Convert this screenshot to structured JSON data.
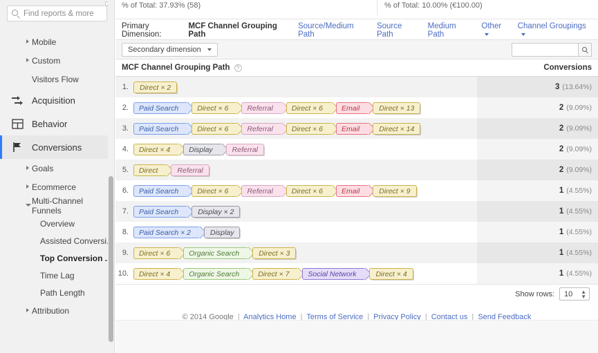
{
  "sidebar": {
    "search_placeholder": "Find reports & more",
    "items": [
      {
        "label": "Mobile",
        "type": "sub",
        "icon": "triangle-right-icon"
      },
      {
        "label": "Custom",
        "type": "sub",
        "icon": "triangle-right-icon"
      },
      {
        "label": "Visitors Flow",
        "type": "sub-noarrow",
        "icon": ""
      },
      {
        "label": "Acquisition",
        "type": "section",
        "icon": "acquisition-arrows-icon"
      },
      {
        "label": "Behavior",
        "type": "section",
        "icon": "behavior-grid-icon"
      },
      {
        "label": "Conversions",
        "type": "section-active",
        "icon": "conversions-flag-icon"
      },
      {
        "label": "Goals",
        "type": "sub",
        "icon": "triangle-right-icon"
      },
      {
        "label": "Ecommerce",
        "type": "sub",
        "icon": "triangle-right-icon"
      },
      {
        "label": "Multi-Channel Funnels",
        "type": "sub-open",
        "icon": "triangle-down-icon"
      },
      {
        "label": "Overview",
        "type": "leaf"
      },
      {
        "label": "Assisted Conversi...",
        "type": "leaf"
      },
      {
        "label": "Top Conversion ...",
        "type": "leaf-selected"
      },
      {
        "label": "Time Lag",
        "type": "leaf"
      },
      {
        "label": "Path Length",
        "type": "leaf"
      },
      {
        "label": "Attribution",
        "type": "sub",
        "icon": "triangle-right-icon"
      }
    ]
  },
  "metrics": {
    "left": "% of Total: 37.93% (58)",
    "right": "% of Total: 10.00% (€100.00)"
  },
  "primary_dimension": {
    "label": "Primary Dimension:",
    "current": "MCF Channel Grouping Path",
    "links": [
      "Source/Medium Path",
      "Source Path",
      "Medium Path"
    ],
    "other": "Other",
    "channel_groupings": "Channel Groupings"
  },
  "toolbar": {
    "secondary_dimension": "Secondary dimension",
    "search_value": "",
    "search_icon": "search-icon"
  },
  "table": {
    "col_path": "MCF Channel Grouping Path",
    "col_conversions": "Conversions",
    "sort_arrow": "↓",
    "help_icon": "?",
    "rows": [
      {
        "num": "1.",
        "conv": "3",
        "pct": "(13.64%)",
        "path": [
          {
            "label": "Direct × 2",
            "cls": "c-direct",
            "term": true
          }
        ]
      },
      {
        "num": "2.",
        "conv": "2",
        "pct": "(9.09%)",
        "path": [
          {
            "label": "Paid Search",
            "cls": "c-paid",
            "term": false
          },
          {
            "label": "Direct × 6",
            "cls": "c-direct",
            "term": false
          },
          {
            "label": "Referral",
            "cls": "c-ref",
            "term": false
          },
          {
            "label": "Direct × 6",
            "cls": "c-direct",
            "term": false
          },
          {
            "label": "Email",
            "cls": "c-email",
            "term": false
          },
          {
            "label": "Direct × 13",
            "cls": "c-direct",
            "term": true
          }
        ]
      },
      {
        "num": "3.",
        "conv": "2",
        "pct": "(9.09%)",
        "path": [
          {
            "label": "Paid Search",
            "cls": "c-paid",
            "term": false
          },
          {
            "label": "Direct × 6",
            "cls": "c-direct",
            "term": false
          },
          {
            "label": "Referral",
            "cls": "c-ref",
            "term": false
          },
          {
            "label": "Direct × 6",
            "cls": "c-direct",
            "term": false
          },
          {
            "label": "Email",
            "cls": "c-email",
            "term": false
          },
          {
            "label": "Direct × 14",
            "cls": "c-direct",
            "term": true
          }
        ]
      },
      {
        "num": "4.",
        "conv": "2",
        "pct": "(9.09%)",
        "path": [
          {
            "label": "Direct × 4",
            "cls": "c-direct",
            "term": false
          },
          {
            "label": "Display",
            "cls": "c-display",
            "term": false
          },
          {
            "label": "Referral",
            "cls": "c-ref",
            "term": true
          }
        ]
      },
      {
        "num": "5.",
        "conv": "2",
        "pct": "(9.09%)",
        "path": [
          {
            "label": "Direct",
            "cls": "c-direct",
            "term": false
          },
          {
            "label": "Referral",
            "cls": "c-ref",
            "term": true
          }
        ]
      },
      {
        "num": "6.",
        "conv": "1",
        "pct": "(4.55%)",
        "path": [
          {
            "label": "Paid Search",
            "cls": "c-paid",
            "term": false
          },
          {
            "label": "Direct × 6",
            "cls": "c-direct",
            "term": false
          },
          {
            "label": "Referral",
            "cls": "c-ref",
            "term": false
          },
          {
            "label": "Direct × 6",
            "cls": "c-direct",
            "term": false
          },
          {
            "label": "Email",
            "cls": "c-email",
            "term": false
          },
          {
            "label": "Direct × 9",
            "cls": "c-direct",
            "term": true
          }
        ]
      },
      {
        "num": "7.",
        "conv": "1",
        "pct": "(4.55%)",
        "path": [
          {
            "label": "Paid Search",
            "cls": "c-paid",
            "term": false
          },
          {
            "label": "Display × 2",
            "cls": "c-display",
            "term": true
          }
        ]
      },
      {
        "num": "8.",
        "conv": "1",
        "pct": "(4.55%)",
        "path": [
          {
            "label": "Paid Search × 2",
            "cls": "c-paid",
            "term": false
          },
          {
            "label": "Display",
            "cls": "c-display",
            "term": true
          }
        ]
      },
      {
        "num": "9.",
        "conv": "1",
        "pct": "(4.55%)",
        "path": [
          {
            "label": "Direct × 6",
            "cls": "c-direct",
            "term": false
          },
          {
            "label": "Organic Search",
            "cls": "c-organic",
            "term": false
          },
          {
            "label": "Direct × 3",
            "cls": "c-direct",
            "term": true
          }
        ]
      },
      {
        "num": "10.",
        "conv": "1",
        "pct": "(4.55%)",
        "path": [
          {
            "label": "Direct × 4",
            "cls": "c-direct",
            "term": false
          },
          {
            "label": "Organic Search",
            "cls": "c-organic",
            "term": false
          },
          {
            "label": "Direct × 7",
            "cls": "c-direct",
            "term": false
          },
          {
            "label": "Social Network",
            "cls": "c-social",
            "term": false
          },
          {
            "label": "Direct × 4",
            "cls": "c-direct",
            "term": true
          }
        ]
      }
    ]
  },
  "show_rows": {
    "label": "Show rows:",
    "value": "10"
  },
  "footer": {
    "copyright": "© 2014 Google",
    "links": [
      "Analytics Home",
      "Terms of Service",
      "Privacy Policy",
      "Contact us",
      "Send Feedback"
    ]
  }
}
